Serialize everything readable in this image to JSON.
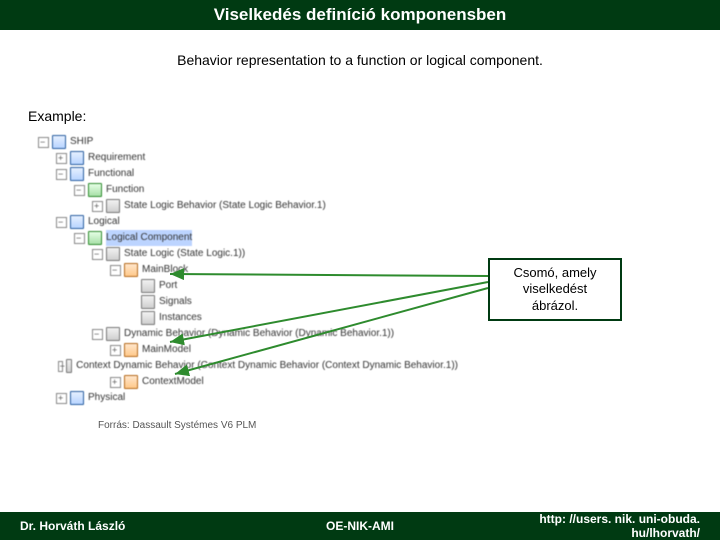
{
  "title": "Viselkedés definíció komponensben",
  "subtitle": "Behavior representation to a function or logical component.",
  "example_label": "Example:",
  "tree": {
    "root": "SHIP",
    "items": [
      {
        "indent": 0,
        "toggle": "minus",
        "icon": "blue",
        "label": "SHIP"
      },
      {
        "indent": 1,
        "toggle": "plus",
        "icon": "blue",
        "label": "Requirement"
      },
      {
        "indent": 1,
        "toggle": "minus",
        "icon": "blue",
        "label": "Functional"
      },
      {
        "indent": 2,
        "toggle": "minus",
        "icon": "green",
        "label": "Function"
      },
      {
        "indent": 3,
        "toggle": "plus",
        "icon": "grey",
        "label": "State Logic Behavior (State Logic Behavior.1)"
      },
      {
        "indent": 1,
        "toggle": "minus",
        "icon": "blue",
        "label": "Logical"
      },
      {
        "indent": 2,
        "toggle": "minus",
        "icon": "green",
        "label": "Logical Component",
        "highlight": true
      },
      {
        "indent": 3,
        "toggle": "minus",
        "icon": "grey",
        "label": "State Logic (State Logic.1))"
      },
      {
        "indent": 4,
        "toggle": "minus",
        "icon": "orange",
        "label": "MainBlock"
      },
      {
        "indent": 5,
        "toggle": "none",
        "icon": "grey",
        "label": "Port"
      },
      {
        "indent": 5,
        "toggle": "none",
        "icon": "grey",
        "label": "Signals"
      },
      {
        "indent": 5,
        "toggle": "none",
        "icon": "grey",
        "label": "Instances"
      },
      {
        "indent": 3,
        "toggle": "minus",
        "icon": "grey",
        "label": "Dynamic Behavior (Dynamic Behavior (Dynamic Behavior.1))"
      },
      {
        "indent": 4,
        "toggle": "plus",
        "icon": "orange",
        "label": "MainModel"
      },
      {
        "indent": 3,
        "toggle": "minus",
        "icon": "grey",
        "label": "Context Dynamic Behavior (Context Dynamic Behavior (Context Dynamic Behavior.1))"
      },
      {
        "indent": 4,
        "toggle": "plus",
        "icon": "orange",
        "label": "ContextModel"
      },
      {
        "indent": 1,
        "toggle": "plus",
        "icon": "blue",
        "label": "Physical"
      }
    ]
  },
  "callout": {
    "line1": "Csomó, amely",
    "line2": "viselkedést",
    "line3": "ábrázol."
  },
  "source": "Forrás: Dassault Systémes V6 PLM",
  "footer": {
    "left": "Dr. Horváth László",
    "center": "OE-NIK-AMI",
    "right": "http: //users. nik. uni-obuda. hu/lhorvath/"
  },
  "colors": {
    "brand_green": "#003a12",
    "arrow_green": "#2e8b2e"
  }
}
